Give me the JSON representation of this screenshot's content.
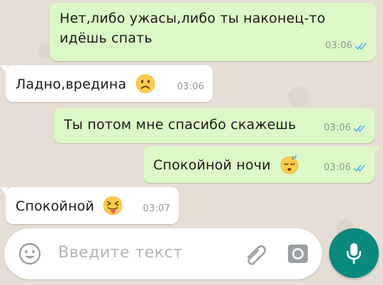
{
  "messages": [
    {
      "direction": "outgoing",
      "lines": [
        "Нет,либо ужасы,либо ты наконец-то",
        "идёшь спать"
      ],
      "time": "03:06",
      "status": "read"
    },
    {
      "direction": "incoming",
      "text": "Ладно,вредина",
      "emoji": "frowning-face-emoji",
      "time": "03:06"
    },
    {
      "direction": "outgoing",
      "text": "Ты потом мне спасибо скажешь",
      "time": "03:06",
      "status": "read"
    },
    {
      "direction": "outgoing",
      "text": "Спокойной ночи",
      "emoji": "sleeping-face-emoji",
      "time": "03:06",
      "status": "read"
    },
    {
      "direction": "incoming",
      "text": "Спокойной",
      "emoji": "squinting-tongue-face-emoji",
      "time": "03:07"
    }
  ],
  "input": {
    "placeholder": "Введите текст",
    "icons": [
      "smiley-icon",
      "paperclip-icon",
      "camera-icon"
    ]
  },
  "mic_button": {
    "icon": "microphone-icon"
  },
  "colors": {
    "outgoing_bubble": "#dcf8c6",
    "incoming_bubble": "#ffffff",
    "read_ticks": "#4fb6ec",
    "accent": "#0a8a7e"
  }
}
